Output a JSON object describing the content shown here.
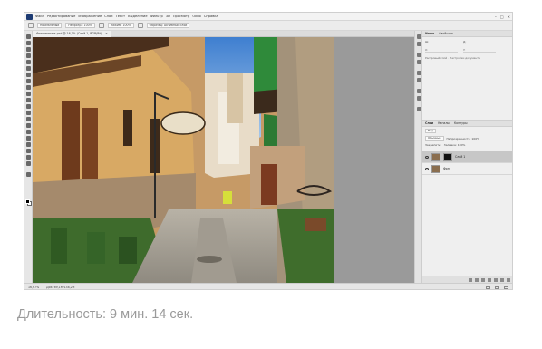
{
  "caption": "Длительность: 9 мин. 14 сек.",
  "colors": {
    "app_chrome": "#ececec",
    "canvas_bg": "#9a9a9a",
    "caption_text": "#9a9a9a",
    "selected_layer": "#c7c7c7"
  },
  "menubar": {
    "items": [
      "Файл",
      "Редактирование",
      "Изображение",
      "Слои",
      "Текст",
      "Выделение",
      "Фильтр",
      "3D",
      "Просмотр",
      "Окно",
      "Справка"
    ],
    "icons": [
      "minimize-icon",
      "maximize-icon",
      "close-icon"
    ]
  },
  "options_bar": {
    "mode": "Нормальный",
    "opacity": "Непрозр.: 100%",
    "flow": "Нажим: 100%",
    "sample": "Образец: Активный слой"
  },
  "document_tab": {
    "title": "Фотомонтаж.psd @ 16,7% (Слой 1, RGB/8*)"
  },
  "panels": {
    "properties": {
      "tabs": [
        "Инфо",
        "Свойства"
      ],
      "fields": [
        [
          "Ш:",
          "Д:"
        ],
        [
          "X:",
          "Y:"
        ]
      ],
      "note": "Растровый слой · Настройки документа"
    },
    "layers": {
      "tabs": [
        "Слои",
        "Каналы",
        "Контуры"
      ],
      "filter": "Вид",
      "blend_mode": "Обычные",
      "opacity": "Непрозрачность: 100%",
      "lock_label": "Закрепить:",
      "fill": "Заливка: 100%",
      "items": [
        {
          "name": "Слой 1",
          "selected": true,
          "has_mask": true
        },
        {
          "name": "Фон",
          "selected": false,
          "has_mask": false
        }
      ]
    }
  },
  "statusbar": {
    "zoom": "16,67%",
    "doc": "Док: 69,1M/138,2M"
  }
}
